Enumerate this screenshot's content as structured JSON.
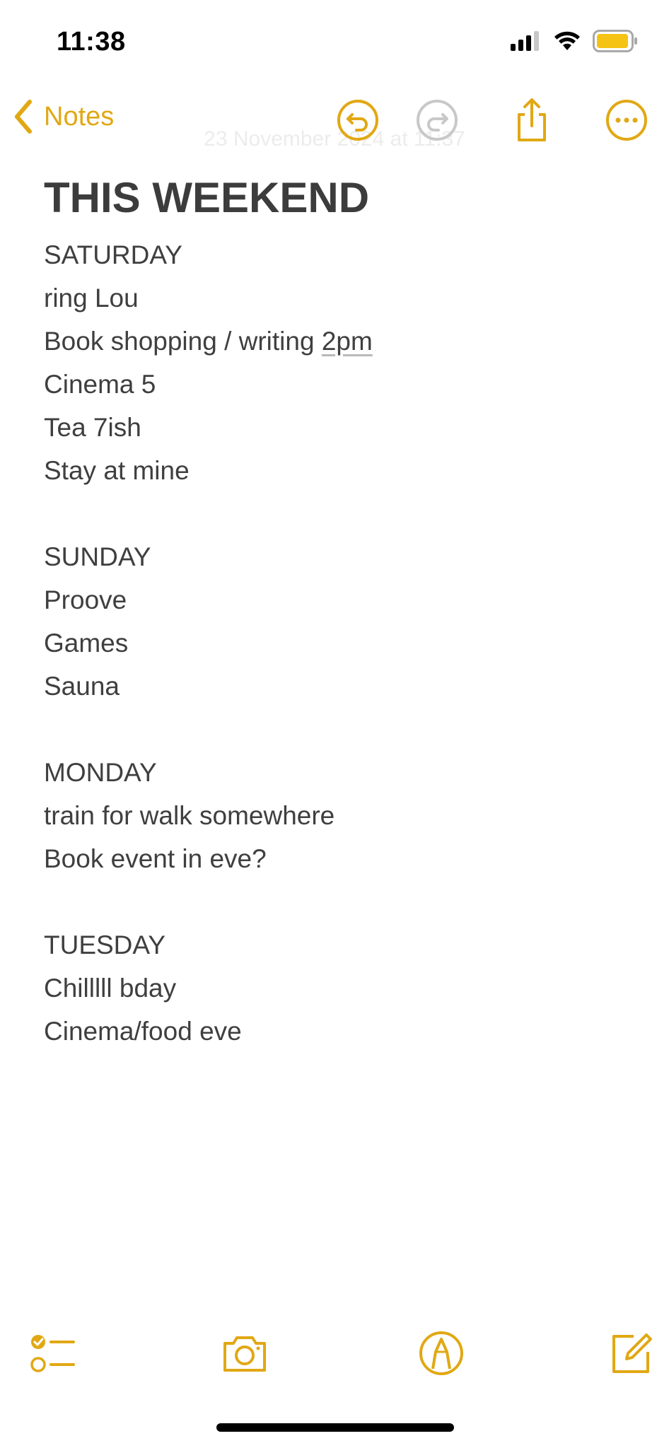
{
  "status_bar": {
    "time": "11:38"
  },
  "nav": {
    "back_label": "Notes",
    "accent_color": "#e1a814",
    "disabled_color": "#c8c8c8",
    "icons": [
      "undo-icon",
      "redo-icon",
      "share-icon",
      "more-icon"
    ]
  },
  "note": {
    "faded_date": "23 November 2024 at 11:37",
    "title": "THIS WEEKEND",
    "saturday": {
      "heading": "SATURDAY",
      "line1": "ring Lou",
      "line2_prefix": "Book shopping / writing ",
      "line2_time": "2pm",
      "line3": "Cinema 5",
      "line4": "Tea 7ish",
      "line5": "Stay at mine"
    },
    "sunday": {
      "heading": "SUNDAY",
      "line1": "Proove",
      "line2": "Games",
      "line3": "Sauna"
    },
    "monday": {
      "heading": "MONDAY",
      "line1": "train for walk somewhere",
      "line2": "Book event in eve?"
    },
    "tuesday": {
      "heading": "TUESDAY",
      "line1": "Chilllll bday",
      "line2": "Cinema/food eve"
    }
  },
  "toolbar": {
    "icons": [
      "checklist-icon",
      "camera-icon",
      "markup-icon",
      "compose-icon"
    ]
  }
}
